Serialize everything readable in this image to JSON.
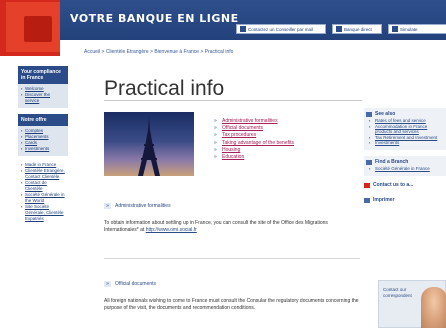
{
  "header": {
    "title": "VOTRE BANQUE EN LIGNE",
    "buttons": [
      "Contactez un Conseiller par mail",
      "Banque direct",
      "Simulate"
    ]
  },
  "breadcrumb": "Accueil > Clientèle Etrangère > Bienvenue à France > Practical info",
  "sidebar": {
    "box1_head": "Your compliance in France",
    "box1_links": [
      "Welcome",
      "Discover the service"
    ],
    "box2_head": "Notre offre",
    "box2_links": [
      "Comptes",
      "Placements",
      "Cards",
      "Investments"
    ],
    "links": [
      "Made in France",
      "Clientèle Etrangère, Contact Clientèle",
      "Contact de Clientèle",
      "Société Générale in the World",
      "Site Société Générale, Clientèle Expatriés"
    ]
  },
  "main": {
    "title": "Practical info",
    "links": [
      "Administrative formalities",
      "Official documents",
      "Tax procedures",
      "Taking advantage of the benefits",
      "Housing",
      "Education"
    ],
    "section1": {
      "head": "Administrative formalities",
      "text": "To obtain information about settling up in France, you can consult the site of the Office des Migrations Internationales* at",
      "link": "http://www.omi.social.fr"
    },
    "section2": {
      "head": "Official documents",
      "text": "All foreign nationals wishing to come to France must consult the Consular the regulatory documents concerning the purpose of the visit, the documents and recommendation conditions."
    }
  },
  "right": {
    "box1": {
      "head": "See also",
      "links": [
        "Rates of fees and service",
        "Accommodation in France products and services",
        "Tax Retirement and Investment",
        "Investments"
      ]
    },
    "box2": {
      "head": "Find a Branch",
      "links": [
        "Société Générale in France"
      ]
    },
    "badge1": "Contact us to a...",
    "badge2": "Imprimer",
    "promo": "Contact our correspondent"
  },
  "colors": {
    "brand_red": "#d5281c",
    "header_blue": "#2b4c88",
    "link_magenta": "#a8205a"
  }
}
